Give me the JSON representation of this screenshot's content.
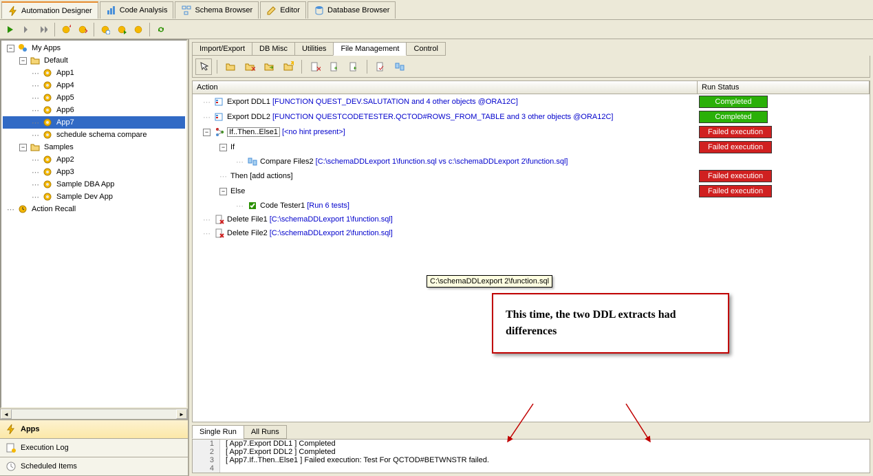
{
  "top_tabs": [
    {
      "label": "Automation Designer",
      "icon": "bolt",
      "active": true
    },
    {
      "label": "Code Analysis",
      "icon": "chart",
      "active": false
    },
    {
      "label": "Schema Browser",
      "icon": "schema",
      "active": false
    },
    {
      "label": "Editor",
      "icon": "edit",
      "active": false
    },
    {
      "label": "Database Browser",
      "icon": "db",
      "active": false
    }
  ],
  "tree": {
    "root": "My Apps",
    "nodes": [
      {
        "indent": 0,
        "label": "My Apps",
        "icon": "apps",
        "toggle": "-"
      },
      {
        "indent": 1,
        "label": "Default",
        "icon": "folder",
        "toggle": "-"
      },
      {
        "indent": 2,
        "label": "App1",
        "icon": "gear"
      },
      {
        "indent": 2,
        "label": "App4",
        "icon": "gear"
      },
      {
        "indent": 2,
        "label": "App5",
        "icon": "gear"
      },
      {
        "indent": 2,
        "label": "App6",
        "icon": "gear"
      },
      {
        "indent": 2,
        "label": "App7",
        "icon": "gear",
        "selected": true
      },
      {
        "indent": 2,
        "label": "schedule schema compare",
        "icon": "gear"
      },
      {
        "indent": 1,
        "label": "Samples",
        "icon": "folder",
        "toggle": "-"
      },
      {
        "indent": 2,
        "label": "App2",
        "icon": "gear"
      },
      {
        "indent": 2,
        "label": "App3",
        "icon": "gear"
      },
      {
        "indent": 2,
        "label": "Sample DBA App",
        "icon": "gear"
      },
      {
        "indent": 2,
        "label": "Sample Dev App",
        "icon": "gear"
      },
      {
        "indent": 0,
        "label": "Action Recall",
        "icon": "recall"
      }
    ]
  },
  "nav_sections": [
    {
      "label": "Apps",
      "icon": "bolt",
      "active": true
    },
    {
      "label": "Execution Log",
      "icon": "log",
      "active": false
    },
    {
      "label": "Scheduled Items",
      "icon": "schedule",
      "active": false
    }
  ],
  "inner_tabs": [
    "Import/Export",
    "DB Misc",
    "Utilities",
    "File Management",
    "Control"
  ],
  "inner_active": 3,
  "grid_headers": {
    "action": "Action",
    "status": "Run Status"
  },
  "grid_rows": [
    {
      "indent": 0,
      "icon": "export",
      "name": "Export DDL1",
      "hint": "[FUNCTION QUEST_DEV.SALUTATION and 4 other objects @ORA12C]",
      "status": "Completed",
      "status_class": "completed"
    },
    {
      "indent": 0,
      "icon": "export",
      "name": "Export DDL2",
      "hint": "[FUNCTION QUESTCODETESTER.QCTOD#ROWS_FROM_TABLE and 3 other objects @ORA12C]",
      "status": "Completed",
      "status_class": "completed"
    },
    {
      "indent": 0,
      "icon": "branch",
      "name": "If..Then..Else1",
      "hint": "[<no hint present>]",
      "status": "Failed execution",
      "status_class": "failed",
      "toggle": "-",
      "boxed": true
    },
    {
      "indent": 1,
      "icon": "none",
      "name": "If",
      "hint": "",
      "status": "Failed execution",
      "status_class": "failed",
      "toggle": "-"
    },
    {
      "indent": 2,
      "icon": "compare",
      "name": "Compare Files2",
      "hint": "[C:\\schemaDDLexport 1\\function.sql vs c:\\schemaDDLexport 2\\function.sql]"
    },
    {
      "indent": 1,
      "icon": "none",
      "name": "Then [add actions]",
      "hint": "",
      "status": "Failed execution",
      "status_class": "failed"
    },
    {
      "indent": 1,
      "icon": "none",
      "name": "Else",
      "hint": "",
      "status": "Failed execution",
      "status_class": "failed",
      "toggle": "-"
    },
    {
      "indent": 2,
      "icon": "tester",
      "name": "Code Tester1",
      "hint": "[Run 6 tests]"
    },
    {
      "indent": 0,
      "icon": "delete",
      "name": "Delete File1",
      "hint": "[C:\\schemaDDLexport 1\\function.sql]"
    },
    {
      "indent": 0,
      "icon": "delete",
      "name": "Delete File2",
      "hint": "[C:\\schemaDDLexport 2\\function.sql]"
    }
  ],
  "tooltip": "C:\\schemaDDLexport 2\\function.sql",
  "callout": "This time, the two DDL extracts had differences",
  "bottom_tabs": [
    "Single Run",
    "All Runs"
  ],
  "bottom_active": 0,
  "log_lines": [
    "[ App7.Export DDL1 ] Completed",
    "[ App7.Export DDL2 ] Completed",
    "[ App7.If..Then..Else1 ] Failed execution: Test For QCTOD#BETWNSTR failed.",
    ""
  ]
}
